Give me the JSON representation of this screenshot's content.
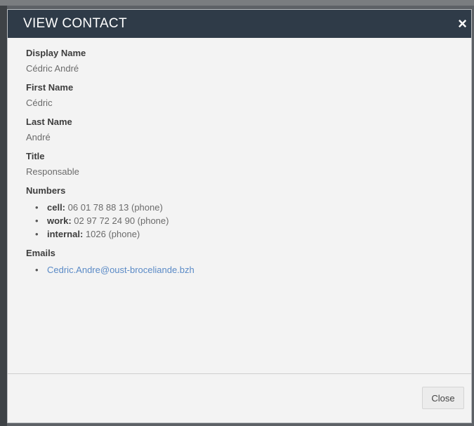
{
  "dialog": {
    "title": "VIEW CONTACT",
    "close_icon": "×"
  },
  "fields": {
    "display_name": {
      "label": "Display Name",
      "value": "Cédric André"
    },
    "first_name": {
      "label": "First Name",
      "value": "Cédric"
    },
    "last_name": {
      "label": "Last Name",
      "value": "André"
    },
    "title": {
      "label": "Title",
      "value": "Responsable"
    }
  },
  "numbers": {
    "label": "Numbers",
    "items": [
      {
        "type": "cell:",
        "value": "06 01 78 88 13 (phone)"
      },
      {
        "type": "work:",
        "value": "02 97 72 24 90 (phone)"
      },
      {
        "type": "internal:",
        "value": "1026 (phone)"
      }
    ]
  },
  "emails": {
    "label": "Emails",
    "items": [
      "Cedric.Andre@oust-broceliande.bzh"
    ]
  },
  "footer": {
    "close_label": "Close"
  }
}
